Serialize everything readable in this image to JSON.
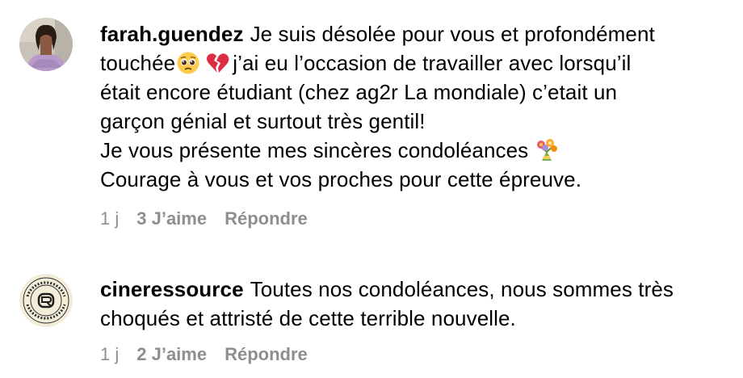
{
  "comments": [
    {
      "username": "farah.guendez",
      "text_lines": [
        "Je suis désolée pour vous et profondément",
        "touchée",
        "j’ai eu l’occasion de travailler avec lorsqu’il",
        "était encore étudiant (chez ag2r La mondiale) c’etait un",
        "garçon génial et surtout très gentil!",
        "Je vous présente mes sincères condoléances",
        "Courage à vous et vos proches pour cette épreuve."
      ],
      "age": "1 j",
      "likes": "3 J’aime",
      "reply": "Répondre",
      "emojis": [
        "pleading-face-emoji",
        "broken-heart-emoji",
        "bouquet-emoji"
      ]
    },
    {
      "username": "cineressource",
      "text_lines": [
        "Toutes nos condoléances, nous sommes très",
        "choqués et attristé de cette terrible nouvelle."
      ],
      "age": "1 j",
      "likes": "2 J’aime",
      "reply": "Répondre"
    }
  ],
  "colors": {
    "meta_text": "#8e8e8e",
    "text": "#000000",
    "background": "#ffffff"
  }
}
